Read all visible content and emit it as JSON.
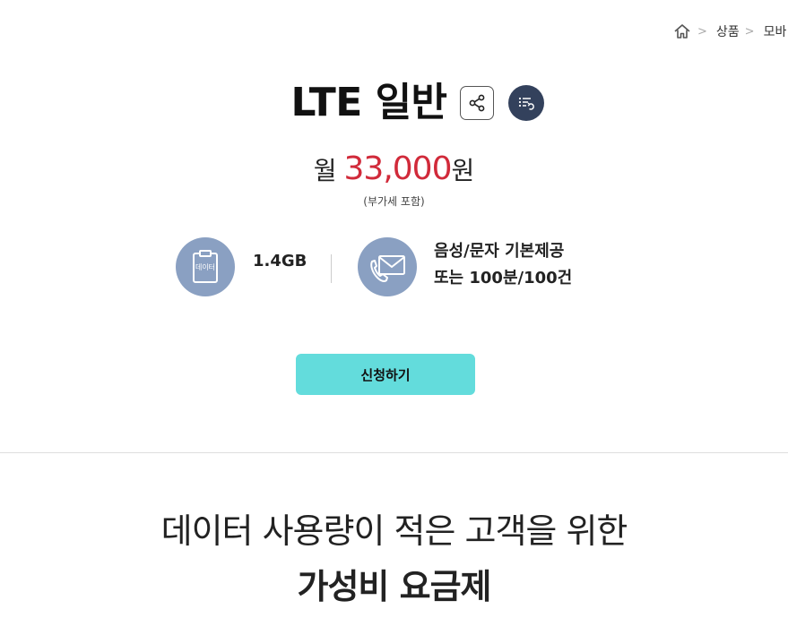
{
  "breadcrumb": {
    "items": [
      "상품",
      "모바"
    ]
  },
  "header": {
    "plan_title": "LTE 일반"
  },
  "price": {
    "prefix": "월",
    "value": "33,000",
    "suffix": "원",
    "vat_note": "(부가세 포함)"
  },
  "features": {
    "data_icon_label": "데이터",
    "data_amount": "1.4GB",
    "voice_line1": "음성/문자 기본제공",
    "voice_line2": "또는 100분/100건"
  },
  "actions": {
    "apply_label": "신청하기"
  },
  "promo": {
    "line1": "데이터 사용량이 적은 고객을 위한",
    "line2": "가성비 요금제"
  },
  "colors": {
    "price": "#d12a3a",
    "apply_button": "#63dcdc",
    "feature_icon_bg": "#8aa0c2",
    "list_button_bg": "#33415c"
  },
  "icons": {
    "home": "home-icon",
    "share": "share-icon",
    "list": "list-icon",
    "data": "clipboard-icon",
    "voice": "phone-mail-icon"
  }
}
